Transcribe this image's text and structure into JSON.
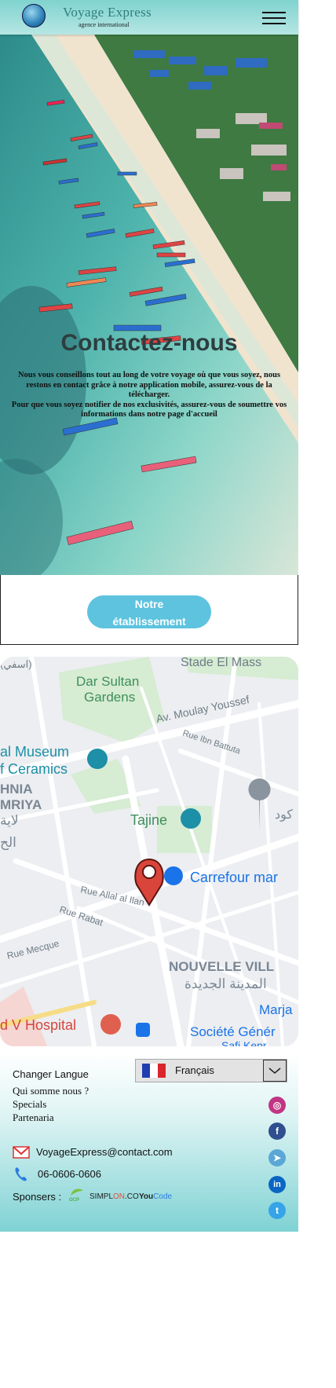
{
  "header": {
    "brand": "Voyage Express",
    "tagline": "agence international"
  },
  "hero": {
    "title": "Contactez-nous",
    "text": "Nous vous conseillons tout au long de votre voyage où que vous soyez, nous restons en contact grâce à notre application mobile, assurez-vous de la télécharger.",
    "text2": "Pour que vous soyez notifier de nos exclusivités, assurez-vous de soumettre vos informations dans notre page d'accueil"
  },
  "cta": {
    "line1": "Notre",
    "line2": "établissement"
  },
  "map": {
    "labels": {
      "stade": "Stade El Mass",
      "arabic_top": "(اسفي)",
      "dar1": "Dar Sultan",
      "dar2": "Gardens",
      "moulay": "Av. Moulay Youssef",
      "ibn": "Rue Ibn Battuta",
      "museum1": "al Museum",
      "museum2": "f Ceramics",
      "hnia": "HNIA",
      "mriya": "MRIYA",
      "ar1": "لاية",
      "ar2": "الح",
      "tajine": "Tajine",
      "kod": "كود",
      "carrefour": "Carrefour mar",
      "allal": "Rue Allal al Ilan",
      "rabat": "Rue Rabat",
      "mecque": "Rue Mecque",
      "nouvelle": "NOUVELLE VILL",
      "ar_nouvelle": "المدينة الجديدة",
      "marja": "Marja",
      "hospital": "d V Hospital",
      "societe": "Société Génér",
      "saf": "Safi Kenr"
    }
  },
  "footer": {
    "change_lang": "Changer Langue",
    "lang_value": "Français",
    "links": [
      "Qui somme nous ?",
      "Specials",
      "Partenaria"
    ],
    "email": "VoyageExpress@contact.com",
    "phone": "06-0606-0606",
    "sponsors_label": "Sponsers :",
    "sponsor_simplon": "SIMPL",
    "sponsor_simplon_on": "ON",
    "sponsor_simplon_co": ".CO",
    "sponsor_youcode_you": "You",
    "sponsor_youcode_code": "Code",
    "sponsor_oop": "OCP"
  },
  "colors": {
    "accent": "#5dc3df",
    "header": "#7fd3cf",
    "brand": "#2f7f7a"
  },
  "icons": [
    "globe-icon",
    "menu-icon",
    "map-pin-icon",
    "mail-icon",
    "phone-icon",
    "instagram-icon",
    "facebook-icon",
    "telegram-icon",
    "linkedin-icon",
    "twitter-icon"
  ]
}
